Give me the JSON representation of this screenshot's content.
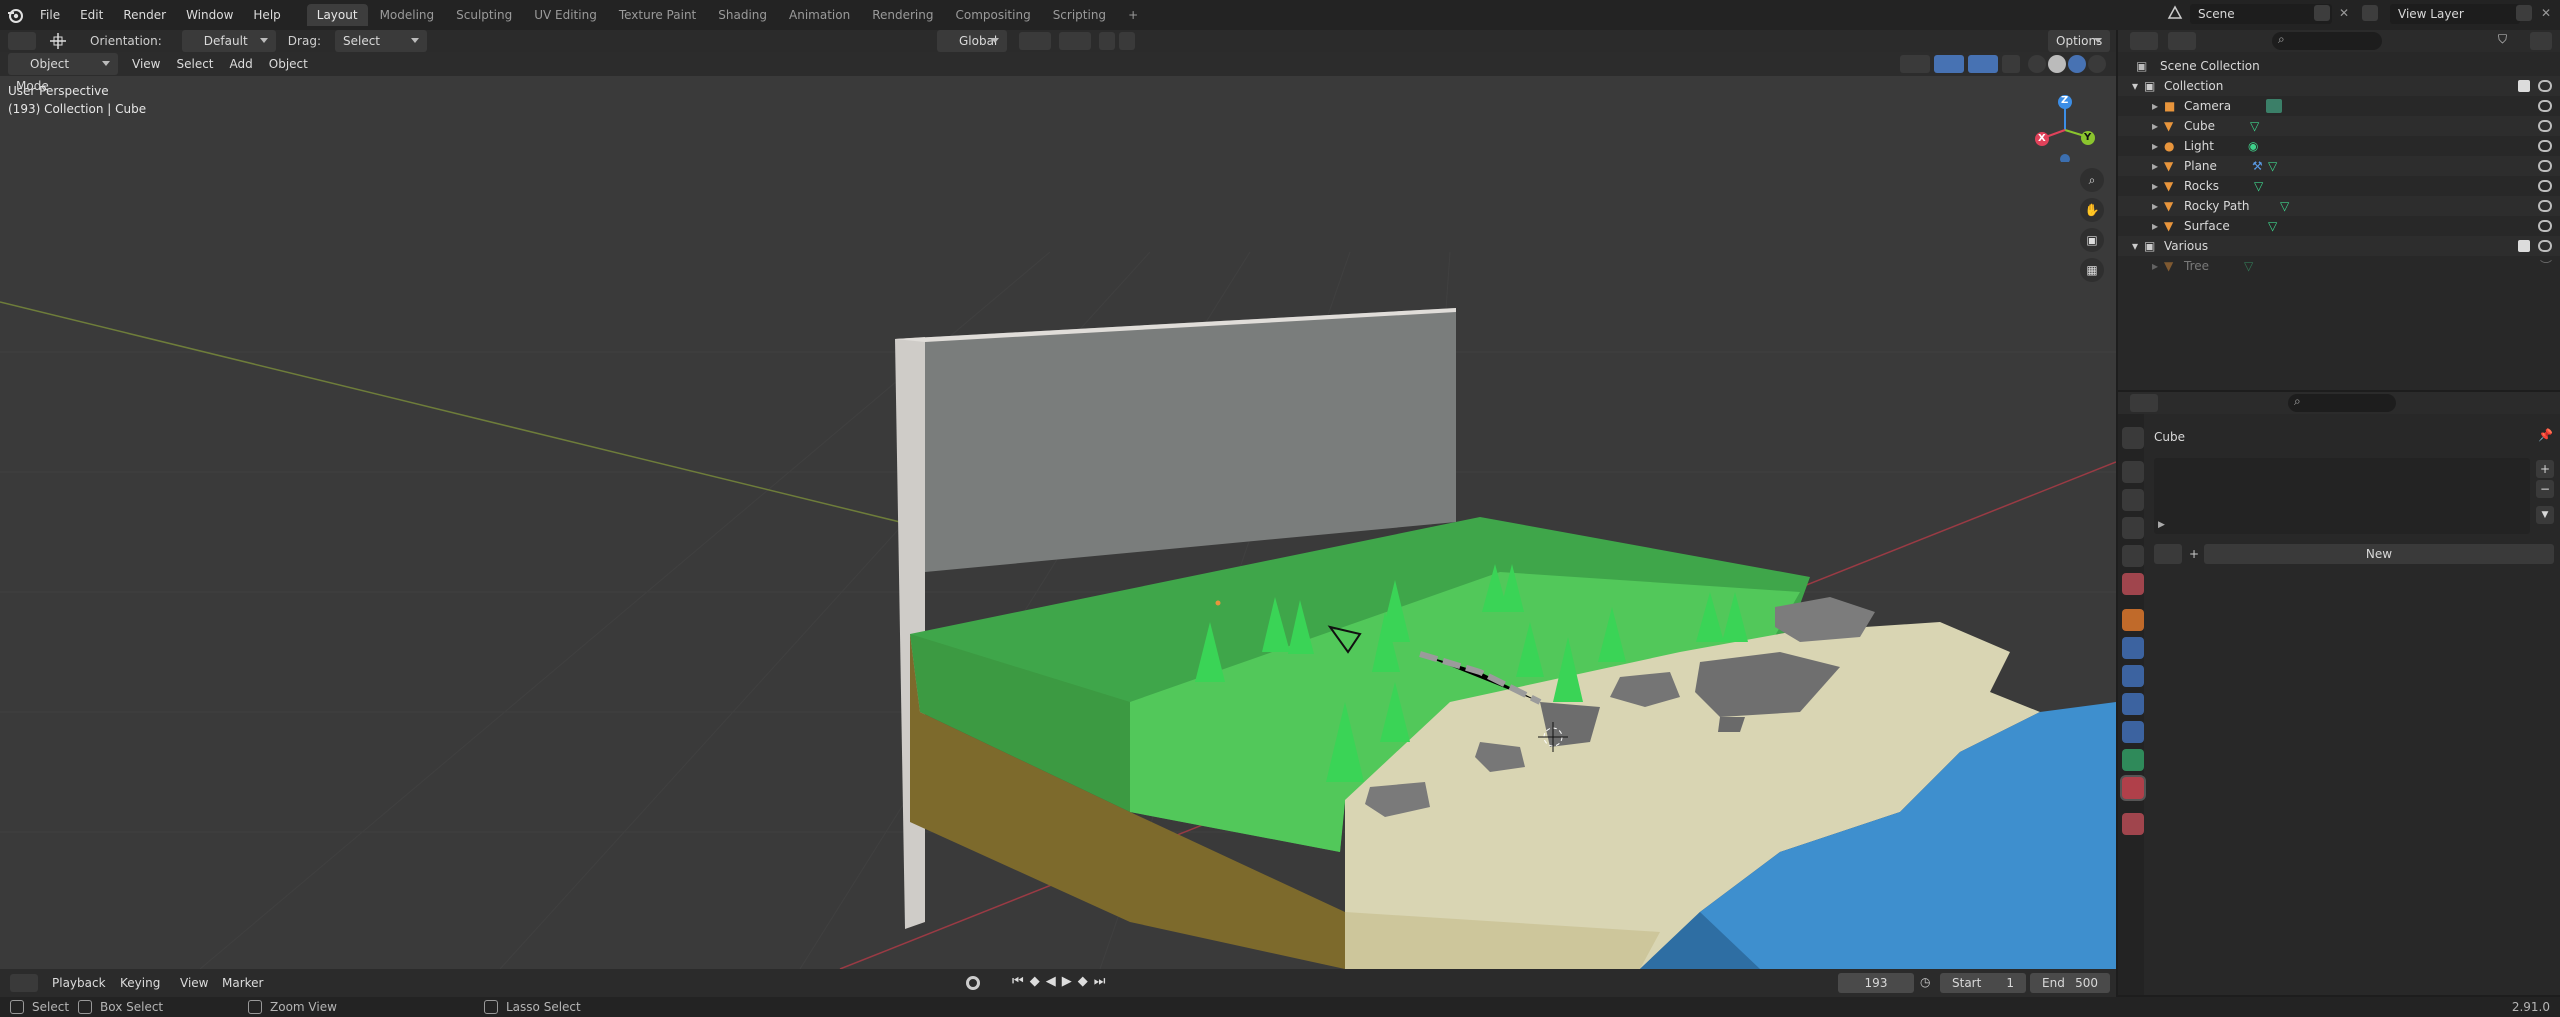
{
  "topbar": {
    "menus": [
      "File",
      "Edit",
      "Render",
      "Window",
      "Help"
    ],
    "workspaces": [
      "Layout",
      "Modeling",
      "Sculpting",
      "UV Editing",
      "Texture Paint",
      "Shading",
      "Animation",
      "Rendering",
      "Compositing",
      "Scripting"
    ],
    "active_workspace": "Layout",
    "add_tab": "+",
    "scene": "Scene",
    "view_layer": "View Layer"
  },
  "tool_header": {
    "orientation_label": "Orientation:",
    "orientation_value": "Default",
    "drag_label": "Drag:",
    "drag_value": "Select Box",
    "transform_orientation": "Global",
    "options": "Options"
  },
  "viewport_header": {
    "mode": "Object Mode",
    "menus": [
      "View",
      "Select",
      "Add",
      "Object"
    ]
  },
  "viewport": {
    "perspective": "User Perspective",
    "collection_info": "(193) Collection | Cube",
    "gizmo": {
      "x": "X",
      "y": "Y",
      "z": "Z"
    }
  },
  "outliner": {
    "root": "Scene Collection",
    "items": [
      {
        "name": "Collection",
        "type": "collection"
      },
      {
        "name": "Camera",
        "type": "camera"
      },
      {
        "name": "Cube",
        "type": "mesh"
      },
      {
        "name": "Light",
        "type": "light"
      },
      {
        "name": "Plane",
        "type": "mesh"
      },
      {
        "name": "Rocks",
        "type": "mesh"
      },
      {
        "name": "Rocky Path",
        "type": "mesh"
      },
      {
        "name": "Surface",
        "type": "mesh"
      },
      {
        "name": "Various",
        "type": "collection"
      },
      {
        "name": "Tree",
        "type": "mesh"
      }
    ]
  },
  "properties": {
    "object_name": "Cube",
    "new_button": "New",
    "add": "+",
    "remove": "−"
  },
  "timeline": {
    "menus": [
      "Playback",
      "Keying",
      "View",
      "Marker"
    ],
    "current_frame": "193",
    "start_label": "Start",
    "start_value": "1",
    "end_label": "End",
    "end_value": "500"
  },
  "statusbar": {
    "items": [
      "Select",
      "Box Select",
      "Zoom View",
      "Lasso Select"
    ],
    "version": "2.91.0"
  },
  "colors": {
    "accent": "#4772b3",
    "object_orange": "#e8953c",
    "mesh_green": "#3fd38b",
    "x_axis": "#e0425a",
    "y_axis": "#8ac42e",
    "z_axis": "#3c8ee6"
  }
}
